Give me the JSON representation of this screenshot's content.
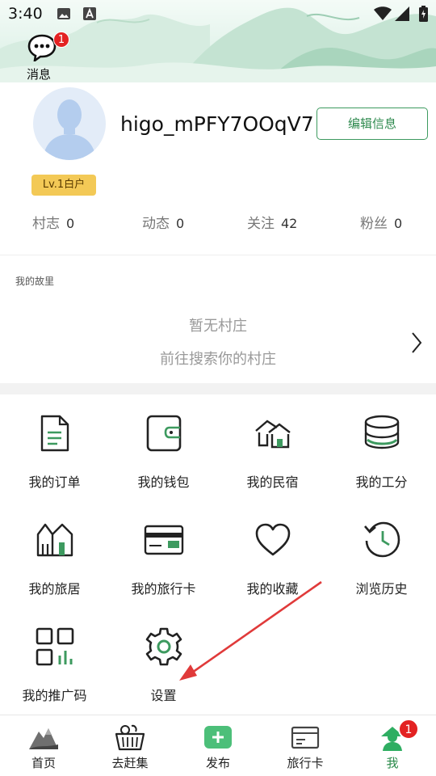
{
  "status_bar": {
    "time": "3:40"
  },
  "header": {
    "messages_label": "消息",
    "messages_badge": "1"
  },
  "profile": {
    "username": "higo_mPFY7OOqV7",
    "edit_button": "编辑信息",
    "level": "Lv.1白户"
  },
  "stats": [
    {
      "label": "村志",
      "value": "0"
    },
    {
      "label": "动态",
      "value": "0"
    },
    {
      "label": "关注",
      "value": "42"
    },
    {
      "label": "粉丝",
      "value": "0"
    }
  ],
  "story": {
    "title": "我的故里",
    "empty_line1": "暂无村庄",
    "empty_line2": "前往搜索你的村庄"
  },
  "grid": [
    {
      "label": "我的订单",
      "icon": "order-icon"
    },
    {
      "label": "我的钱包",
      "icon": "wallet-icon"
    },
    {
      "label": "我的民宿",
      "icon": "homestay-icon"
    },
    {
      "label": "我的工分",
      "icon": "coins-icon"
    },
    {
      "label": "我的旅居",
      "icon": "travel-stay-icon"
    },
    {
      "label": "我的旅行卡",
      "icon": "travel-card-icon"
    },
    {
      "label": "我的收藏",
      "icon": "heart-icon"
    },
    {
      "label": "浏览历史",
      "icon": "history-icon"
    },
    {
      "label": "我的推广码",
      "icon": "qr-code-icon"
    },
    {
      "label": "设置",
      "icon": "gear-icon"
    }
  ],
  "bottom_nav": {
    "items": [
      {
        "label": "首页",
        "icon": "mountain-home-icon"
      },
      {
        "label": "去赶集",
        "icon": "basket-icon"
      },
      {
        "label": "发布",
        "icon": "plus-icon"
      },
      {
        "label": "旅行卡",
        "icon": "card-icon"
      },
      {
        "label": "我",
        "icon": "user-icon"
      }
    ],
    "me_badge": "1"
  },
  "colors": {
    "accent": "#3d9a5f",
    "badge": "#e32222",
    "level": "#f3c956",
    "annotation": "#e03a3a"
  }
}
